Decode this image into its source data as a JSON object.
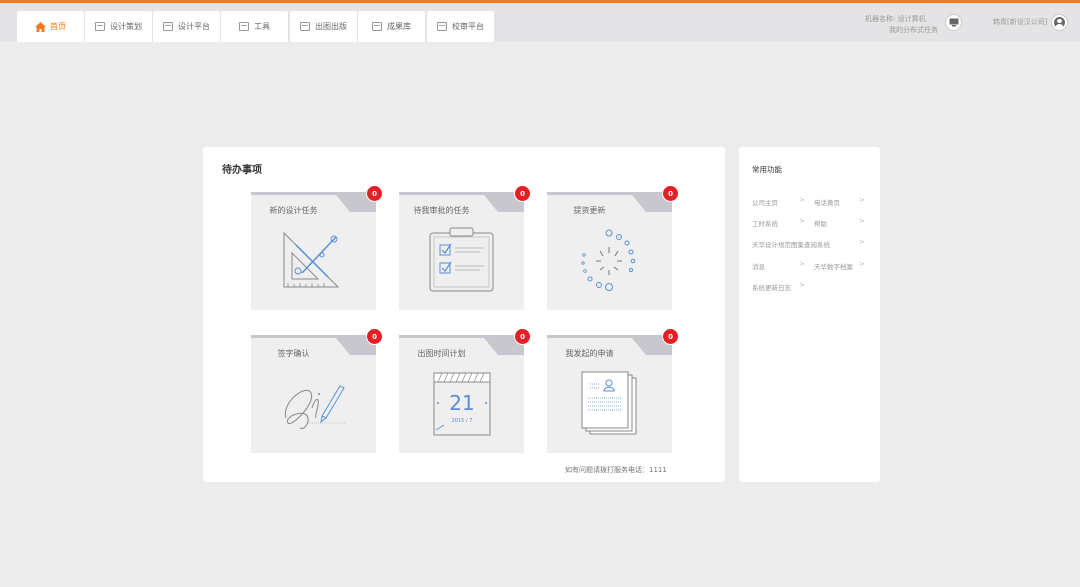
{
  "colors": {
    "accent": "#f47a20",
    "badge": "#e81e25"
  },
  "tabs": [
    {
      "label": "首页",
      "icon": "home-icon"
    },
    {
      "label": "设计策划",
      "icon": "plan-icon"
    },
    {
      "label": "设计平台",
      "icon": "design-platform-icon"
    },
    {
      "label": "工具",
      "icon": "toolbox-icon"
    },
    {
      "label": "出图出版",
      "icon": "publish-icon"
    },
    {
      "label": "成果库",
      "icon": "archive-icon"
    },
    {
      "label": "校审平台",
      "icon": "review-icon"
    }
  ],
  "header": {
    "machine_label": "机器名称:",
    "machine_name": "设计算机",
    "task_link": "我的分布式任务",
    "user": "韩青[新设汉公司]"
  },
  "todo": {
    "title": "待办事项",
    "cards": [
      {
        "label": "新的设计任务",
        "count": "0",
        "icon": "drafting-tools-icon"
      },
      {
        "label": "待我审批的任务",
        "count": "0",
        "icon": "clipboard-checklist-icon"
      },
      {
        "label": "提资更新",
        "count": "0",
        "icon": "loading-spinner-icon"
      },
      {
        "label": "签字确认",
        "count": "0",
        "icon": "signature-pen-icon"
      },
      {
        "label": "出图时间计划",
        "count": "0",
        "icon": "calendar-icon",
        "day": "21",
        "month": "2015 / 7"
      },
      {
        "label": "我发起的申请",
        "count": "0",
        "icon": "application-documents-icon"
      }
    ],
    "hotline": "如有问题请拨打服务电话：1111"
  },
  "common": {
    "title": "常用功能",
    "links": [
      "公司主页",
      "电话黄页",
      "工时系统",
      "帮助",
      "天华设计规范图集查阅系统",
      "消息",
      "天华数字档案",
      "系统更新日志"
    ]
  }
}
